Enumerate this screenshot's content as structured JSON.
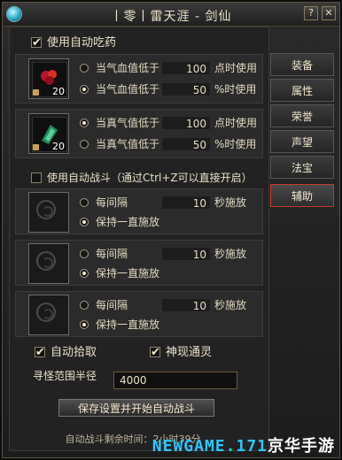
{
  "window": {
    "title": "丨零丨雷天涯 - 剑仙",
    "help": "?",
    "close": "✕"
  },
  "tabs": [
    "装备",
    "属性",
    "荣誉",
    "声望",
    "法宝",
    "辅助"
  ],
  "auto_potion": {
    "label": "使用自动吃药",
    "hp": {
      "count": "20",
      "opt1_text": "当气血值低于",
      "opt1_value": "100",
      "opt1_unit": "点时使用",
      "opt2_text": "当气血值低于",
      "opt2_value": "50",
      "opt2_unit": "%时使用"
    },
    "mp": {
      "count": "20",
      "opt1_text": "当真气值低于",
      "opt1_value": "100",
      "opt1_unit": "点时使用",
      "opt2_text": "当真气值低于",
      "opt2_value": "50",
      "opt2_unit": "%时使用"
    }
  },
  "auto_battle": {
    "label": "使用自动战斗（通过Ctrl+Z可以直接开启）",
    "skills": [
      {
        "every": "每间隔",
        "value": "10",
        "unit": "秒施放",
        "keep": "保持一直施放"
      },
      {
        "every": "每间隔",
        "value": "10",
        "unit": "秒施放",
        "keep": "保持一直施放"
      },
      {
        "every": "每间隔",
        "value": "10",
        "unit": "秒施放",
        "keep": "保持一直施放"
      }
    ]
  },
  "options": {
    "auto_pickup": "自动拾取",
    "divine": "神现通灵",
    "range_label": "寻怪范围半径",
    "range_value": "4000",
    "save_button": "保存设置并开始自动战斗",
    "status": "自动战斗剩余时间：2小时39分"
  },
  "watermark": {
    "en": "NEWGAME.171",
    "cn": "京华手游"
  }
}
